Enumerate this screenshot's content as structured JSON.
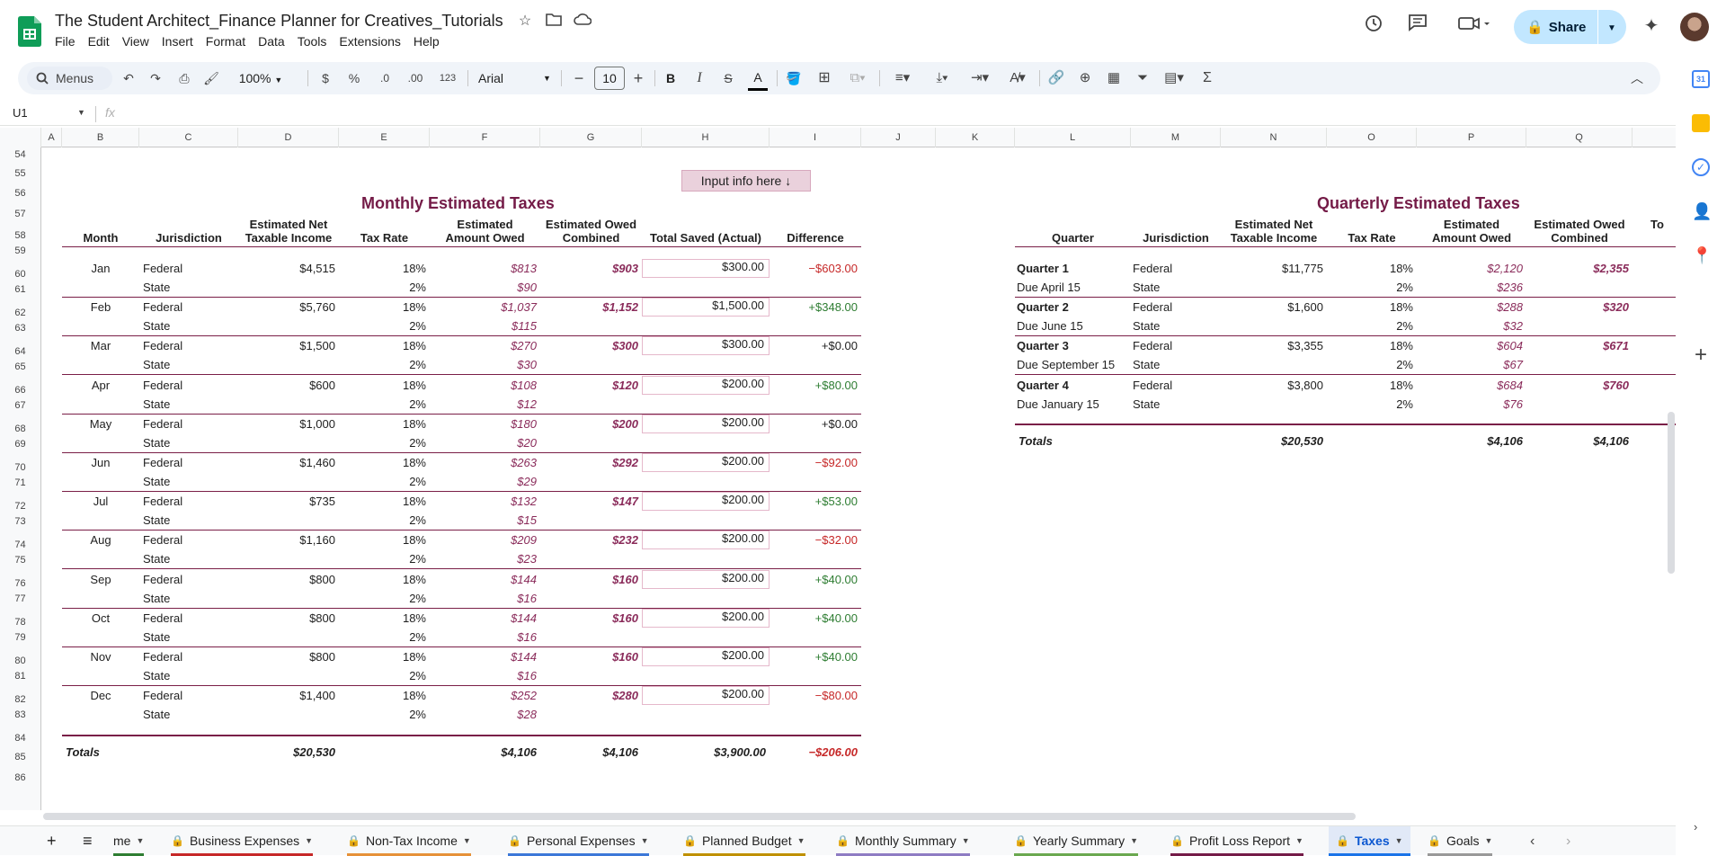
{
  "app": {
    "title": "The Student Architect_Finance Planner for Creatives_Tutorials"
  },
  "menu": [
    "File",
    "Edit",
    "View",
    "Insert",
    "Format",
    "Data",
    "Tools",
    "Extensions",
    "Help"
  ],
  "share_label": "Share",
  "toolbar": {
    "search_label": "Menus",
    "zoom": "100%",
    "currency": "$",
    "percent": "%",
    "dec_decrease": ".0",
    "dec_increase": ".00",
    "num_format": "123",
    "font": "Arial",
    "font_size": "10"
  },
  "namebox": "U1",
  "fx": "fx",
  "columns": [
    "A",
    "B",
    "C",
    "D",
    "E",
    "F",
    "G",
    "H",
    "I",
    "J",
    "K",
    "L",
    "M",
    "N",
    "O",
    "P",
    "Q"
  ],
  "rows": [
    "54",
    "55",
    "56",
    "57",
    "58",
    "59",
    "60",
    "61",
    "62",
    "63",
    "64",
    "65",
    "66",
    "67",
    "68",
    "69",
    "70",
    "71",
    "72",
    "73",
    "74",
    "75",
    "76",
    "77",
    "78",
    "79",
    "80",
    "81",
    "82",
    "83",
    "84",
    "85",
    "86"
  ],
  "input_banner": "Input info here ↓",
  "monthly": {
    "title": "Monthly Estimated Taxes",
    "headers": {
      "month": "Month",
      "jurisdiction": "Jurisdiction",
      "net": "Estimated Net\nTaxable Income",
      "rate": "Tax Rate",
      "owed": "Estimated\nAmount Owed",
      "combined": "Estimated Owed\nCombined",
      "saved": "Total Saved (Actual)",
      "diff": "Difference"
    },
    "months": [
      {
        "month": "Jan",
        "fed_income": "$4,515",
        "fed_rate": "18%",
        "fed_owed": "$813",
        "combined": "$903",
        "saved": "$300.00",
        "diff": "−$603.00",
        "sign": "neg",
        "state_rate": "2%",
        "state_owed": "$90"
      },
      {
        "month": "Feb",
        "fed_income": "$5,760",
        "fed_rate": "18%",
        "fed_owed": "$1,037",
        "combined": "$1,152",
        "saved": "$1,500.00",
        "diff": "+$348.00",
        "sign": "pos",
        "state_rate": "2%",
        "state_owed": "$115"
      },
      {
        "month": "Mar",
        "fed_income": "$1,500",
        "fed_rate": "18%",
        "fed_owed": "$270",
        "combined": "$300",
        "saved": "$300.00",
        "diff": "+$0.00",
        "sign": "zero",
        "state_rate": "2%",
        "state_owed": "$30"
      },
      {
        "month": "Apr",
        "fed_income": "$600",
        "fed_rate": "18%",
        "fed_owed": "$108",
        "combined": "$120",
        "saved": "$200.00",
        "diff": "+$80.00",
        "sign": "pos",
        "state_rate": "2%",
        "state_owed": "$12"
      },
      {
        "month": "May",
        "fed_income": "$1,000",
        "fed_rate": "18%",
        "fed_owed": "$180",
        "combined": "$200",
        "saved": "$200.00",
        "diff": "+$0.00",
        "sign": "zero",
        "state_rate": "2%",
        "state_owed": "$20"
      },
      {
        "month": "Jun",
        "fed_income": "$1,460",
        "fed_rate": "18%",
        "fed_owed": "$263",
        "combined": "$292",
        "saved": "$200.00",
        "diff": "−$92.00",
        "sign": "neg",
        "state_rate": "2%",
        "state_owed": "$29"
      },
      {
        "month": "Jul",
        "fed_income": "$735",
        "fed_rate": "18%",
        "fed_owed": "$132",
        "combined": "$147",
        "saved": "$200.00",
        "diff": "+$53.00",
        "sign": "pos",
        "state_rate": "2%",
        "state_owed": "$15"
      },
      {
        "month": "Aug",
        "fed_income": "$1,160",
        "fed_rate": "18%",
        "fed_owed": "$209",
        "combined": "$232",
        "saved": "$200.00",
        "diff": "−$32.00",
        "sign": "neg",
        "state_rate": "2%",
        "state_owed": "$23"
      },
      {
        "month": "Sep",
        "fed_income": "$800",
        "fed_rate": "18%",
        "fed_owed": "$144",
        "combined": "$160",
        "saved": "$200.00",
        "diff": "+$40.00",
        "sign": "pos",
        "state_rate": "2%",
        "state_owed": "$16"
      },
      {
        "month": "Oct",
        "fed_income": "$800",
        "fed_rate": "18%",
        "fed_owed": "$144",
        "combined": "$160",
        "saved": "$200.00",
        "diff": "+$40.00",
        "sign": "pos",
        "state_rate": "2%",
        "state_owed": "$16"
      },
      {
        "month": "Nov",
        "fed_income": "$800",
        "fed_rate": "18%",
        "fed_owed": "$144",
        "combined": "$160",
        "saved": "$200.00",
        "diff": "+$40.00",
        "sign": "pos",
        "state_rate": "2%",
        "state_owed": "$16"
      },
      {
        "month": "Dec",
        "fed_income": "$1,400",
        "fed_rate": "18%",
        "fed_owed": "$252",
        "combined": "$280",
        "saved": "$200.00",
        "diff": "−$80.00",
        "sign": "neg",
        "state_rate": "2%",
        "state_owed": "$28"
      }
    ],
    "federal_label": "Federal",
    "state_label": "State",
    "totals": {
      "label": "Totals",
      "net": "$20,530",
      "owed": "$4,106",
      "combined": "$4,106",
      "saved": "$3,900.00",
      "diff": "−$206.00"
    }
  },
  "quarterly": {
    "title": "Quarterly Estimated Taxes",
    "headers": {
      "quarter": "Quarter",
      "jurisdiction": "Jurisdiction",
      "net": "Estimated Net\nTaxable Income",
      "rate": "Tax Rate",
      "owed": "Estimated\nAmount Owed",
      "combined": "Estimated Owed\nCombined",
      "cut": "To"
    },
    "quarters": [
      {
        "quarter": "Quarter 1",
        "due": "Due April 15",
        "fed_income": "$11,775",
        "fed_rate": "18%",
        "fed_owed": "$2,120",
        "combined": "$2,355",
        "state_rate": "2%",
        "state_owed": "$236"
      },
      {
        "quarter": "Quarter 2",
        "due": "Due June 15",
        "fed_income": "$1,600",
        "fed_rate": "18%",
        "fed_owed": "$288",
        "combined": "$320",
        "state_rate": "2%",
        "state_owed": "$32"
      },
      {
        "quarter": "Quarter 3",
        "due": "Due September 15",
        "fed_income": "$3,355",
        "fed_rate": "18%",
        "fed_owed": "$604",
        "combined": "$671",
        "state_rate": "2%",
        "state_owed": "$67"
      },
      {
        "quarter": "Quarter 4",
        "due": "Due January 15",
        "fed_income": "$3,800",
        "fed_rate": "18%",
        "fed_owed": "$684",
        "combined": "$760",
        "state_rate": "2%",
        "state_owed": "$76"
      }
    ],
    "totals": {
      "label": "Totals",
      "net": "$20,530",
      "owed": "$4,106",
      "combined": "$4,106"
    }
  },
  "tabs": [
    {
      "label": "me",
      "lock": false,
      "color": "#2e7d32"
    },
    {
      "label": "Business Expenses",
      "lock": true,
      "color": "#c62828"
    },
    {
      "label": "Non-Tax Income",
      "lock": true,
      "color": "#e69138"
    },
    {
      "label": "Personal Expenses",
      "lock": true,
      "color": "#3c78d8"
    },
    {
      "label": "Planned Budget",
      "lock": true,
      "color": "#bf9000"
    },
    {
      "label": "Monthly Summary",
      "lock": true,
      "color": "#8e7cc3"
    },
    {
      "label": "Yearly Summary",
      "lock": true,
      "color": "#6aa84f"
    },
    {
      "label": "Profit Loss Report",
      "lock": true,
      "color": "#741b47"
    },
    {
      "label": "Taxes",
      "lock": true,
      "color": "#1a73e8",
      "active": true
    },
    {
      "label": "Goals",
      "lock": true,
      "color": "#999999"
    }
  ]
}
